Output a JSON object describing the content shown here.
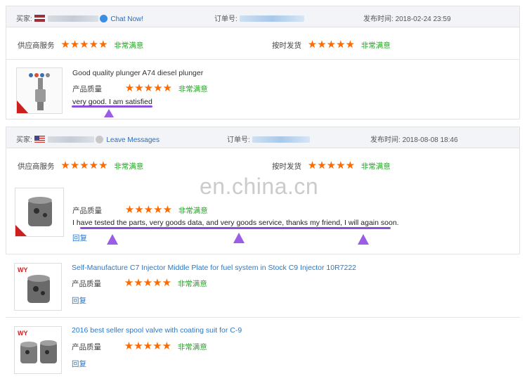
{
  "colors": {
    "star": "#ff6a00",
    "positive": "#2aa22a",
    "link": "#2a78c8",
    "annotation": "#8b4fd9",
    "header_bg": "#f2f4f7"
  },
  "labels": {
    "buyer": "买家:",
    "order_no": "订单号:",
    "published": "发布时间:",
    "supplier_service": "供应商服务",
    "on_time_delivery": "按时发货",
    "product_quality": "产品质量",
    "very_satisfied": "非常满意",
    "reply": "回复",
    "stars": "★★★★★"
  },
  "reviews": [
    {
      "flag": "latvia-flag",
      "contact": "Chat Now!",
      "contact_icon": "chat-icon",
      "published_time": "2018-02-24 23:59",
      "supplier_rating": 5,
      "delivery_rating": 5,
      "product_title": "Good quality plunger A74 diesel plunger",
      "product_rating": 5,
      "comment": "very good. I am satisfied"
    },
    {
      "flag": "usa-flag",
      "contact": "Leave Messages",
      "contact_icon": "offline-icon",
      "published_time": "2018-08-08 18:46",
      "supplier_rating": 5,
      "delivery_rating": 5,
      "product_rating": 5,
      "comment": "I have tested the parts, very goods data, and very goods service, thanks my friend, I will again soon."
    }
  ],
  "products": [
    {
      "title": "Self-Manufacture C7 Injector Middle Plate for fuel system in Stock C9 Injector 10R7222",
      "rating": 5
    },
    {
      "title": "2016 best seller spool valve with coating suit for C-9",
      "rating": 5
    }
  ],
  "watermark": "en.china.cn"
}
